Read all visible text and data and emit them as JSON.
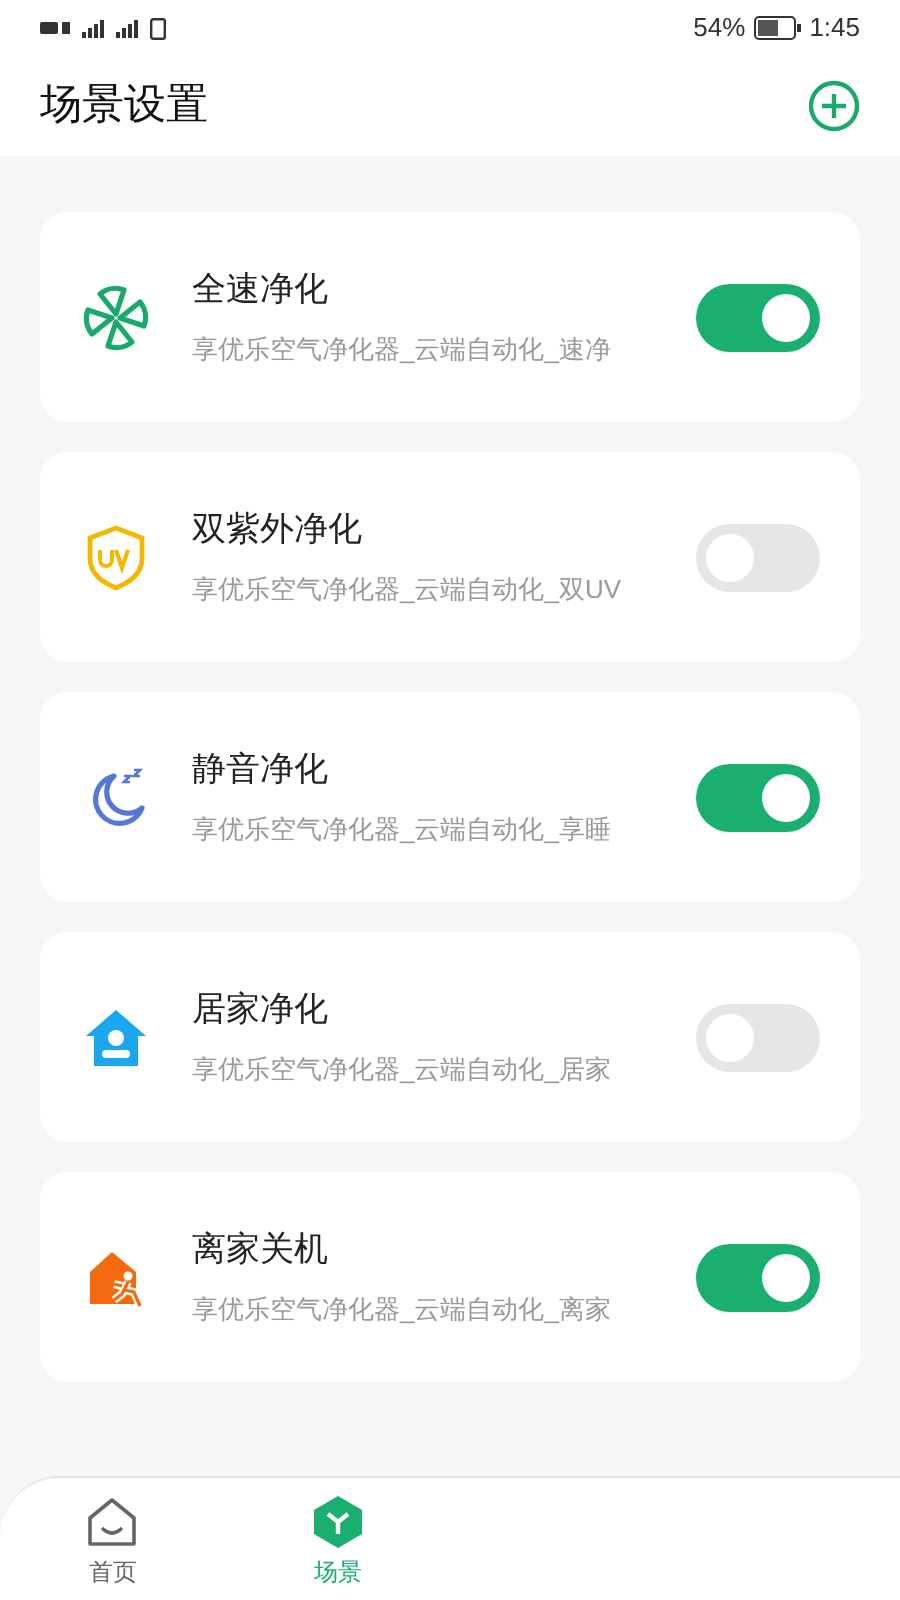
{
  "status_bar": {
    "battery": "54%",
    "time": "1:45"
  },
  "header": {
    "title": "场景设置"
  },
  "scenes": [
    {
      "kind": "fan",
      "name": "全速净化",
      "description": "享优乐空气净化器_云端自动化_速净",
      "on": true
    },
    {
      "kind": "uv",
      "name": "双紫外净化",
      "description": "享优乐空气净化器_云端自动化_双UV",
      "on": false
    },
    {
      "kind": "moon",
      "name": "静音净化",
      "description": "享优乐空气净化器_云端自动化_享睡",
      "on": true
    },
    {
      "kind": "home",
      "name": "居家净化",
      "description": "享优乐空气净化器_云端自动化_居家",
      "on": false
    },
    {
      "kind": "leave",
      "name": "离家关机",
      "description": "享优乐空气净化器_云端自动化_离家",
      "on": true
    }
  ],
  "tab_bar": [
    {
      "kind": "home",
      "label": "首页",
      "selected": false
    },
    {
      "kind": "scene",
      "label": "场景",
      "selected": true
    }
  ]
}
